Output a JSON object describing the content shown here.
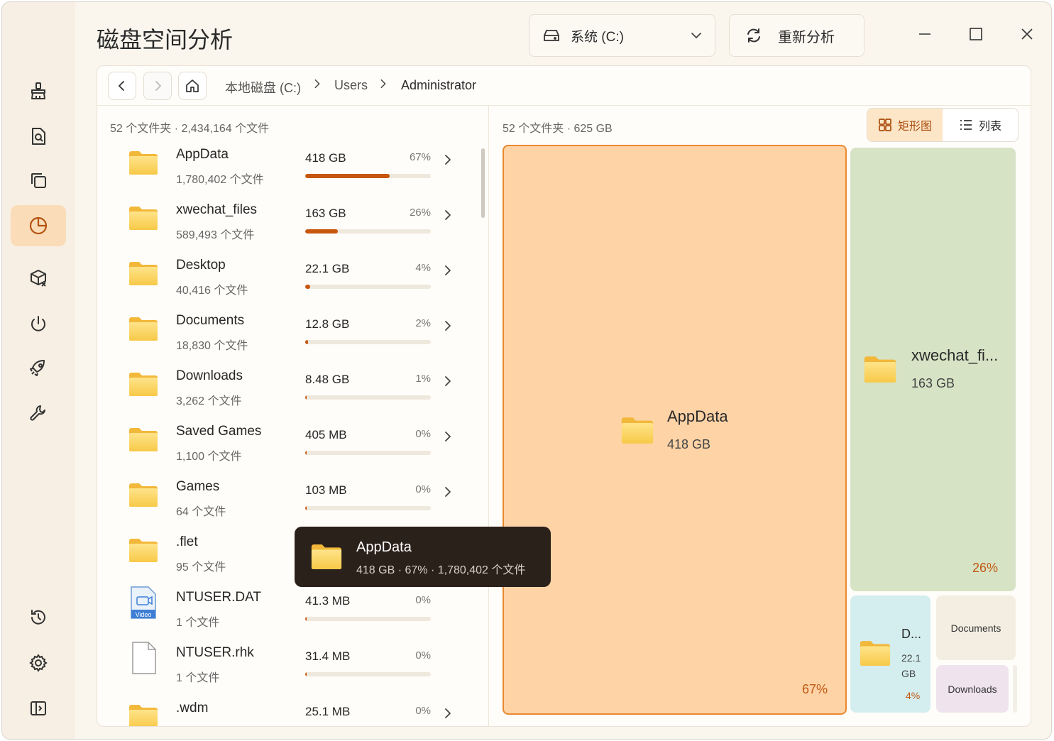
{
  "app": {
    "title": "磁盘空间分析"
  },
  "drive_select": {
    "label": "系统 (C:)"
  },
  "reanalyze": {
    "label": "重新分析"
  },
  "breadcrumb": {
    "items": [
      "本地磁盘 (C:)",
      "Users",
      "Administrator"
    ]
  },
  "left_summary": "52 个文件夹 · 2,434,164 个文件",
  "right_summary": "52 个文件夹 · 625 GB",
  "view_toggle": {
    "treemap": "矩形图",
    "list": "列表",
    "selected": "treemap"
  },
  "colors": {
    "accent": "#c7570f",
    "appdata_tile": "#fed3a6",
    "xwechat_tile": "#d7e3c5",
    "desktop_tile": "#d4edef",
    "documents_tile": "#f3eee1",
    "downloads_tile": "#efe3ee"
  },
  "items": [
    {
      "name": "AppData",
      "count": "1,780,402 个文件",
      "size": "418 GB",
      "pct": "67%",
      "fraction": 0.67,
      "icon": "folder-icon",
      "chevron": true
    },
    {
      "name": "xwechat_files",
      "count": "589,493 个文件",
      "size": "163 GB",
      "pct": "26%",
      "fraction": 0.26,
      "icon": "folder-icon",
      "chevron": true
    },
    {
      "name": "Desktop",
      "count": "40,416 个文件",
      "size": "22.1 GB",
      "pct": "4%",
      "fraction": 0.04,
      "icon": "folder-icon",
      "chevron": true
    },
    {
      "name": "Documents",
      "count": "18,830 个文件",
      "size": "12.8 GB",
      "pct": "2%",
      "fraction": 0.02,
      "icon": "folder-icon",
      "chevron": true
    },
    {
      "name": "Downloads",
      "count": "3,262 个文件",
      "size": "8.48 GB",
      "pct": "1%",
      "fraction": 0.01,
      "icon": "folder-icon",
      "chevron": true
    },
    {
      "name": "Saved Games",
      "count": "1,100 个文件",
      "size": "405 MB",
      "pct": "0%",
      "fraction": 0.003,
      "icon": "folder-icon",
      "chevron": true
    },
    {
      "name": "Games",
      "count": "64 个文件",
      "size": "103 MB",
      "pct": "0%",
      "fraction": 0.001,
      "icon": "folder-icon",
      "chevron": true
    },
    {
      "name": ".flet",
      "count": "95 个文件",
      "size": "",
      "pct": "",
      "fraction": 0,
      "icon": "folder-icon",
      "chevron": false
    },
    {
      "name": "NTUSER.DAT",
      "count": "1 个文件",
      "size": "41.3 MB",
      "pct": "0%",
      "fraction": 0.0005,
      "icon": "video-file-icon",
      "chevron": false
    },
    {
      "name": "NTUSER.rhk",
      "count": "1 个文件",
      "size": "31.4 MB",
      "pct": "0%",
      "fraction": 0.0004,
      "icon": "file-icon",
      "chevron": false
    },
    {
      "name": ".wdm",
      "count": "",
      "size": "25.1 MB",
      "pct": "0%",
      "fraction": 0.0003,
      "icon": "folder-icon",
      "chevron": true
    }
  ],
  "tooltip": {
    "name": "AppData",
    "detail": "418 GB · 67% · 1,780,402 个文件"
  },
  "treemap": {
    "appdata": {
      "name": "AppData",
      "size": "418 GB",
      "pct": "67%"
    },
    "xwechat": {
      "name": "xwechat_fi...",
      "size": "163 GB",
      "pct": "26%"
    },
    "desktop": {
      "name": "D...",
      "size_line1": "22.1",
      "size_line2": "GB",
      "pct": "4%"
    },
    "documents": {
      "name": "Documents"
    },
    "downloads": {
      "name": "Downloads"
    }
  }
}
